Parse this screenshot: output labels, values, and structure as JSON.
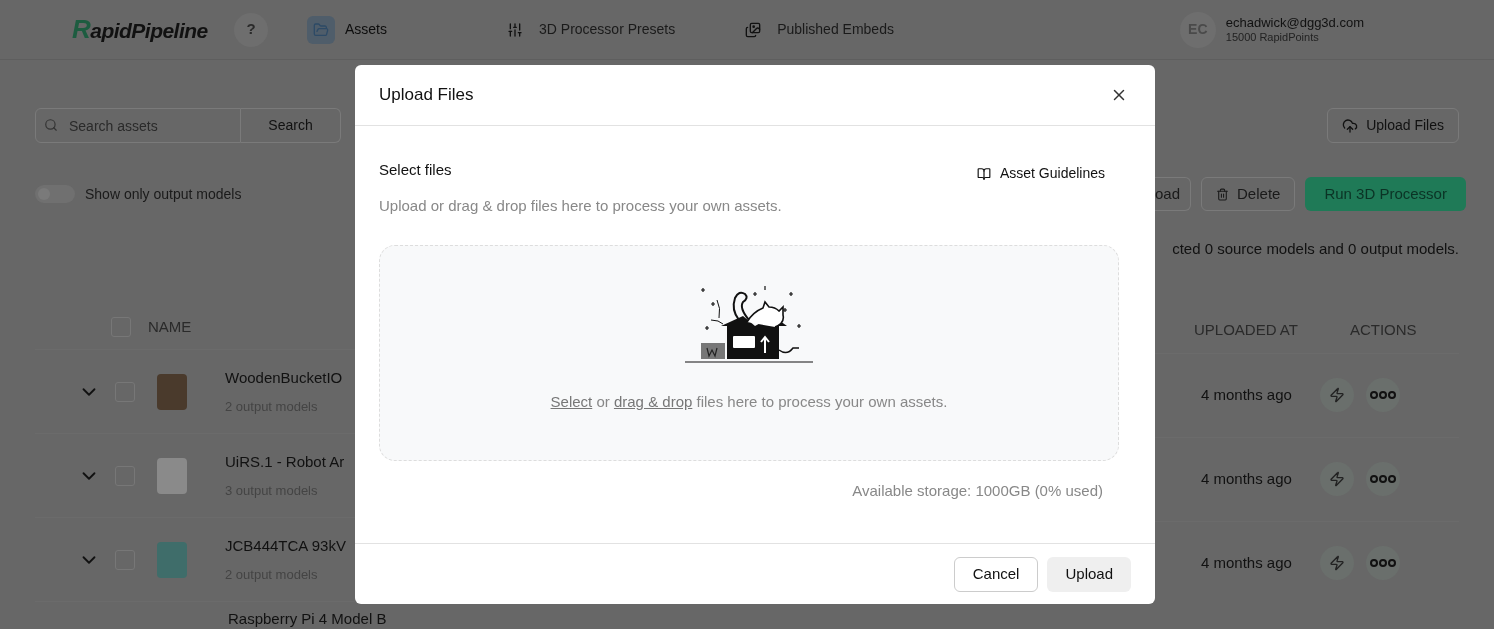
{
  "header": {
    "logo": "RapidPipeline",
    "help": "?",
    "nav": [
      {
        "label": "Assets",
        "kind": "folder",
        "selected": true
      },
      {
        "label": "3D Processor Presets",
        "kind": "sliders",
        "selected": false
      },
      {
        "label": "Published Embeds",
        "kind": "embed",
        "selected": false
      }
    ],
    "user": {
      "initials": "EC",
      "email": "echadwick@dgg3d.com",
      "points": "15000 RapidPoints"
    }
  },
  "toolbar": {
    "search_placeholder": "Search assets",
    "search_button": "Search",
    "upload_button": "Upload Files",
    "toggle": {
      "label": "Show only output models",
      "on": false
    },
    "actions": [
      {
        "label": "oad",
        "kind": "plain"
      },
      {
        "label": "Delete",
        "kind": "delete"
      },
      {
        "label": "Run 3D Processor",
        "kind": "primary"
      }
    ],
    "selection_status": "cted 0 source models and 0 output models."
  },
  "table": {
    "select_all_checked": false,
    "columns": [
      "NAME",
      "UPLOADED AT",
      "ACTIONS"
    ],
    "rows": [
      {
        "name": "WoodenBucketIO",
        "subtitle": "2 output models",
        "uploaded": "4 months ago",
        "checked": false,
        "color": "#4a3a2c"
      },
      {
        "name": "UiRS.1 - Robot Ar",
        "subtitle": "3 output models",
        "uploaded": "4 months ago",
        "checked": false,
        "color": "#8a8a8a"
      },
      {
        "name": "JCB444TCA 93kV",
        "subtitle": "2 output models",
        "uploaded": "4 months ago",
        "checked": false,
        "color": "#3f6d6a"
      }
    ],
    "partial_row": "Raspberry Pi 4 Model B"
  },
  "dialog": {
    "title": "Upload Files",
    "section_title": "Select files",
    "guidelines_link": "Asset Guidelines",
    "subtitle": "Upload or drag & drop files here to process your own assets.",
    "dropzone_text": [
      {
        "text": "Select",
        "kind": "link"
      },
      {
        "text": " or ",
        "kind": "plain"
      },
      {
        "text": "drag & drop",
        "kind": "link"
      },
      {
        "text": " files here to process your own assets.",
        "kind": "plain"
      }
    ],
    "storage": "Available storage: 1000GB (0% used)",
    "buttons": [
      {
        "label": "Cancel",
        "kind": "outline"
      },
      {
        "label": "Upload",
        "kind": "filled"
      }
    ]
  }
}
